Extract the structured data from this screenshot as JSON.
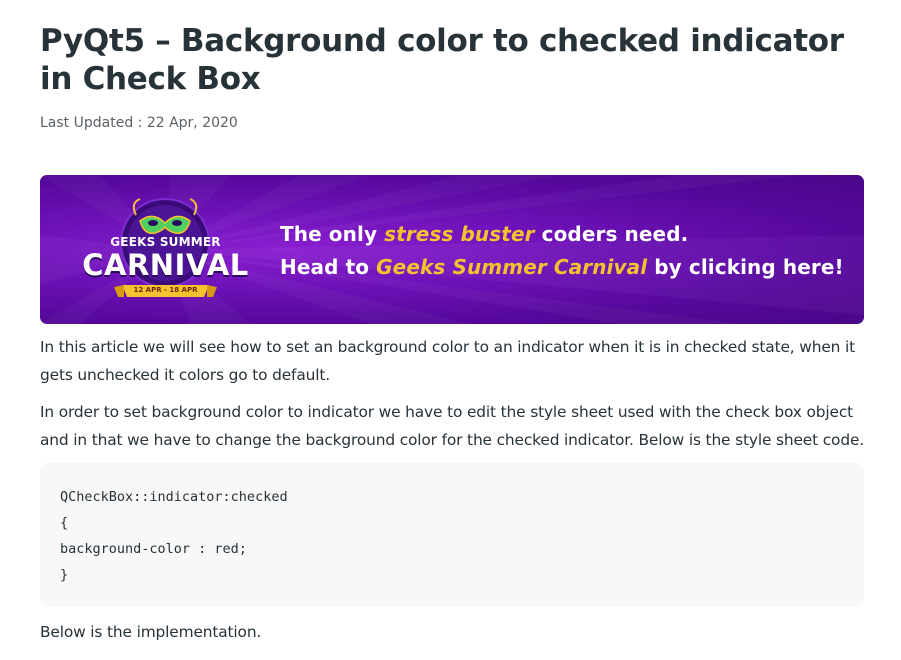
{
  "article": {
    "title": "PyQt5 – Background color to checked indicator in Check Box",
    "last_updated": "Last Updated : 22 Apr, 2020"
  },
  "banner": {
    "logo_top": "GEEKS SUMMER",
    "logo_main": "CARNIVAL",
    "logo_dates": "12 APR - 18 APR",
    "line1_pre": "The only ",
    "line1_hl": "stress buster",
    "line1_post": " coders need.",
    "line2_pre": "Head to ",
    "line2_hl": "Geeks Summer Carnival",
    "line2_post": " by clicking here!",
    "colors": {
      "background": "#6e12b8",
      "highlight": "#f5c12e",
      "text": "#ffffff"
    }
  },
  "body": {
    "para1": "In this article we will see how to set an background color to an indicator when it is in checked state, when it gets unchecked it colors go to default.",
    "para2": "In order to set background color to indicator we have to edit the style sheet used with the check box object and in that we have to change the background color for the checked indicator. Below is the style sheet code.",
    "code_lines": [
      "QCheckBox::indicator:checked",
      "{",
      "background-color : red;",
      "}"
    ],
    "para3": "Below is the implementation."
  }
}
